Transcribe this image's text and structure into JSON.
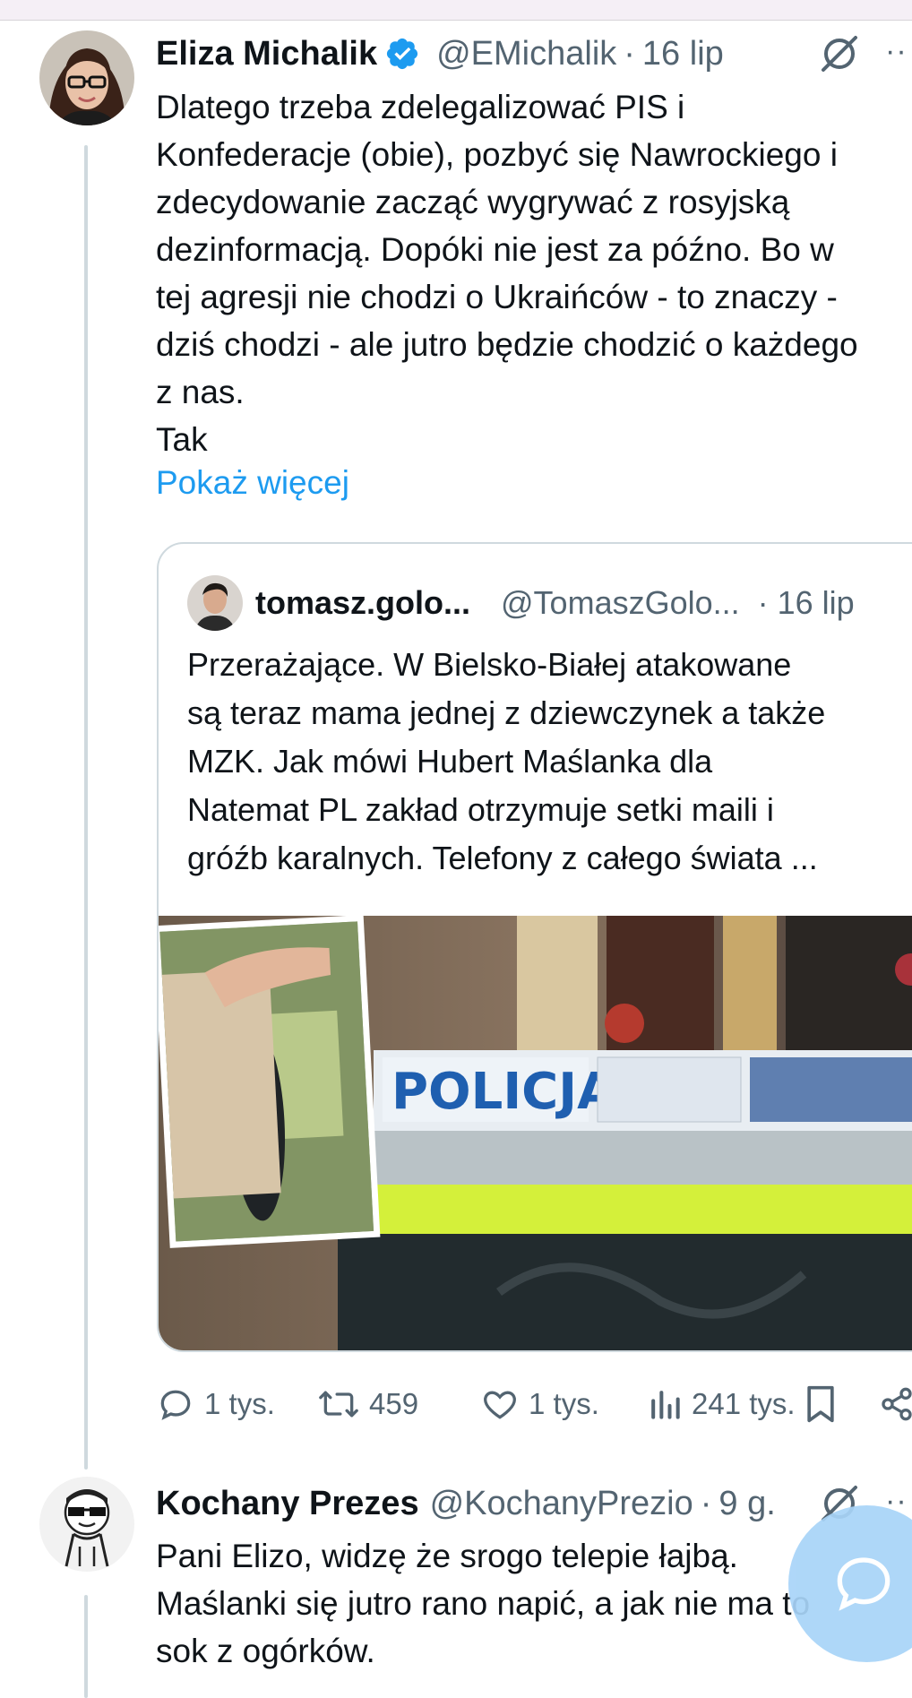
{
  "colors": {
    "link": "#1d9bf0",
    "verified": "#1d9bf0",
    "muted": "#536471",
    "text": "#0f1419",
    "fab": "#a8d4f8"
  },
  "tweet1": {
    "name": "Eliza Michalik",
    "handle": "@EMichalik",
    "time": "16 lip",
    "verified_icon": "verified-badge-icon",
    "text": "Dlatego trzeba zdelegalizować PIS i\nKonfederacje (obie), pozbyć się Nawrockiego i\nzdecydowanie zacząć wygrywać z rosyjską\ndezinformacją. Dopóki nie jest za późno. Bo w\ntej agresji nie chodzi o Ukraińców - to znaczy -\ndziś chodzi - ale jutro będzie chodzić o każdego\nz nas.\nTak",
    "show_more": "Pokaż więcej",
    "quote": {
      "name": "tomasz.golo...",
      "handle": "@TomaszGolo...",
      "time": "· 16 lip",
      "text": "Przerażające. W Bielsko-Białej atakowane\nsą teraz mama jednej z dziewczynek a także\nMZK. Jak mówi Hubert Maślanka dla\nNatemat PL zakład otrzymuje setki maili i\ngróźb karalnych. Telefony z całego świata ...",
      "media_sign": "POLICJA"
    },
    "actions": {
      "replies": "1 tys.",
      "retweets": "459",
      "likes": "1 tys.",
      "views": "241 tys."
    }
  },
  "tweet2": {
    "name": "Kochany Prezes",
    "handle": "@KochanyPrezio",
    "time": "9 g.",
    "text": "Pani Elizo, widzę że srogo telepie łajbą.\nMaślanki się jutro rano napić, a jak nie ma to\nsok z ogórków."
  },
  "separator": "·",
  "more_label": "··"
}
